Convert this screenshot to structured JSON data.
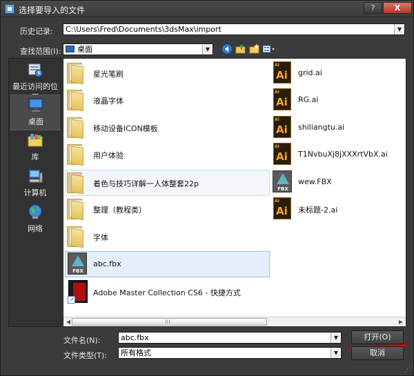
{
  "window": {
    "title": "选择要导入的文件",
    "help_label": "?",
    "close_label": "X"
  },
  "history": {
    "label": "历史记录:",
    "value": "C:\\Users\\Fred\\Documents\\3dsMax\\import"
  },
  "lookin": {
    "label": "查找范围(I):",
    "value": "桌面"
  },
  "places": [
    {
      "label": "最近访问的位置",
      "icon": "recent-places-icon"
    },
    {
      "label": "桌面",
      "icon": "desktop-icon",
      "active": true
    },
    {
      "label": "库",
      "icon": "libraries-icon"
    },
    {
      "label": "计算机",
      "icon": "computer-icon"
    },
    {
      "label": "网络",
      "icon": "network-icon"
    }
  ],
  "files_left": [
    {
      "name": "星光笔刷",
      "type": "folder"
    },
    {
      "name": "液晶字体",
      "type": "folder"
    },
    {
      "name": "移动设备ICON模板",
      "type": "folder"
    },
    {
      "name": "用户体验",
      "type": "folder"
    },
    {
      "name": "着色与技巧详解一人体整套22p",
      "type": "folder"
    },
    {
      "name": "整理（教程类）",
      "type": "folder"
    },
    {
      "name": "字体",
      "type": "folder"
    },
    {
      "name": "abc.fbx",
      "type": "fbx"
    },
    {
      "name": "Adobe Master Collection CS6 - 快捷方式",
      "type": "shortcut"
    }
  ],
  "files_right": [
    {
      "name": "grid.ai",
      "type": "ai"
    },
    {
      "name": "RG.ai",
      "type": "ai"
    },
    {
      "name": "shiliangtu.ai",
      "type": "ai"
    },
    {
      "name": "T1NvbuXj8jXXXrtVbX.ai",
      "type": "ai"
    },
    {
      "name": "wew.FBX",
      "type": "fbx"
    },
    {
      "name": "未标题-2.ai",
      "type": "ai"
    }
  ],
  "icon_text": {
    "ai_tag": "AI",
    "ai_big": "Ai",
    "fbx": "FBX"
  },
  "filename": {
    "label": "文件名(N):",
    "value": "abc.fbx"
  },
  "filetype": {
    "label": "文件类型(T):",
    "value": "所有格式"
  },
  "buttons": {
    "open": "打开(O)",
    "cancel": "取消"
  },
  "colors": {
    "dialog_bg": "#3b3b3b",
    "selection": "#e4effb",
    "annotation_red": "#e00000"
  }
}
